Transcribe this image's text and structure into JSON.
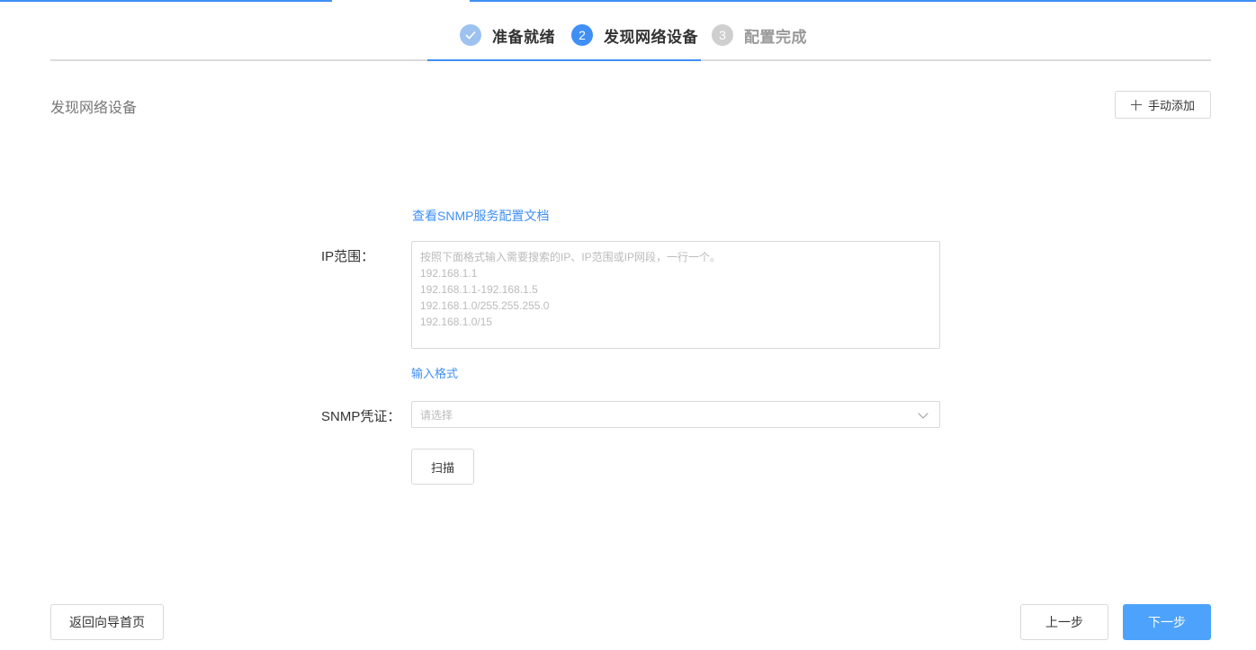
{
  "steps": [
    {
      "number": "",
      "icon": "check-icon",
      "label": "准备就绪",
      "state": "done"
    },
    {
      "number": "2",
      "label": "发现网络设备",
      "state": "active"
    },
    {
      "number": "3",
      "label": "配置完成",
      "state": "pending"
    }
  ],
  "colors": {
    "primary": "#3f8ff5",
    "primary_button": "#4da3fb",
    "done_step": "#9ec2f0",
    "pending_step": "#cfcfcf"
  },
  "section": {
    "title": "发现网络设备",
    "manual_add_label": "手动添加"
  },
  "form": {
    "doc_link": "查看SNMP服务配置文档",
    "ip_label": "IP范围：",
    "ip_placeholder_lines": [
      "按照下面格式输入需要搜索的IP、IP范围或IP网段，一行一个。",
      "192.168.1.1",
      "192.168.1.1-192.168.1.5",
      "192.168.1.0/255.255.255.0",
      "192.168.1.0/15"
    ],
    "format_link": "输入格式",
    "snmp_label": "SNMP凭证：",
    "snmp_placeholder": "请选择",
    "scan_label": "扫描"
  },
  "footer": {
    "back_home_label": "返回向导首页",
    "prev_label": "上一步",
    "next_label": "下一步"
  }
}
